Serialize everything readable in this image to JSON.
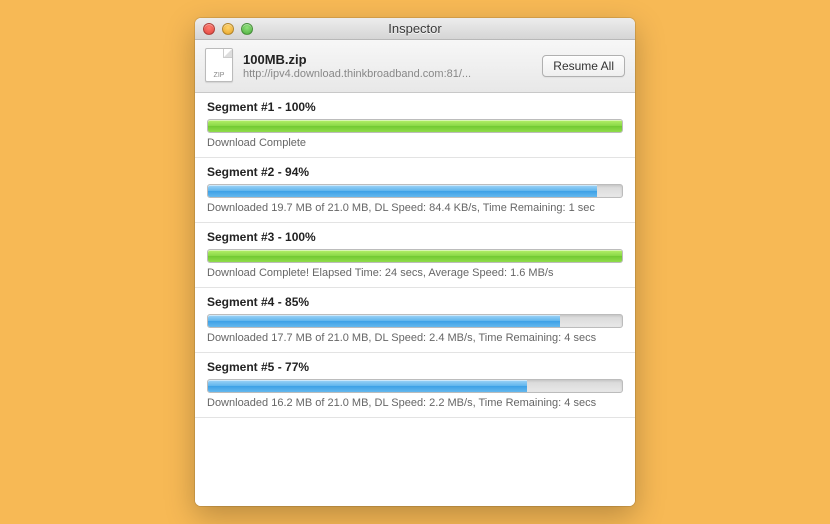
{
  "window": {
    "title": "Inspector"
  },
  "header": {
    "file_name": "100MB.zip",
    "file_ext": "ZIP",
    "file_url": "http://ipv4.download.thinkbroadband.com:81/...",
    "resume_label": "Resume All"
  },
  "segments": [
    {
      "title": "Segment #1 - 100%",
      "percent": 100,
      "color": "green",
      "status": "Download Complete"
    },
    {
      "title": "Segment #2 - 94%",
      "percent": 94,
      "color": "blue",
      "status": "Downloaded 19.7 MB of 21.0 MB, DL Speed: 84.4 KB/s, Time Remaining: 1 sec"
    },
    {
      "title": "Segment #3 - 100%",
      "percent": 100,
      "color": "green",
      "status": "Download Complete! Elapsed Time: 24 secs, Average Speed: 1.6 MB/s"
    },
    {
      "title": "Segment #4 - 85%",
      "percent": 85,
      "color": "blue",
      "status": "Downloaded 17.7 MB of 21.0 MB, DL Speed: 2.4 MB/s, Time Remaining: 4 secs"
    },
    {
      "title": "Segment #5 - 77%",
      "percent": 77,
      "color": "blue",
      "status": "Downloaded 16.2 MB of 21.0 MB, DL Speed: 2.2 MB/s, Time Remaining: 4 secs"
    }
  ]
}
